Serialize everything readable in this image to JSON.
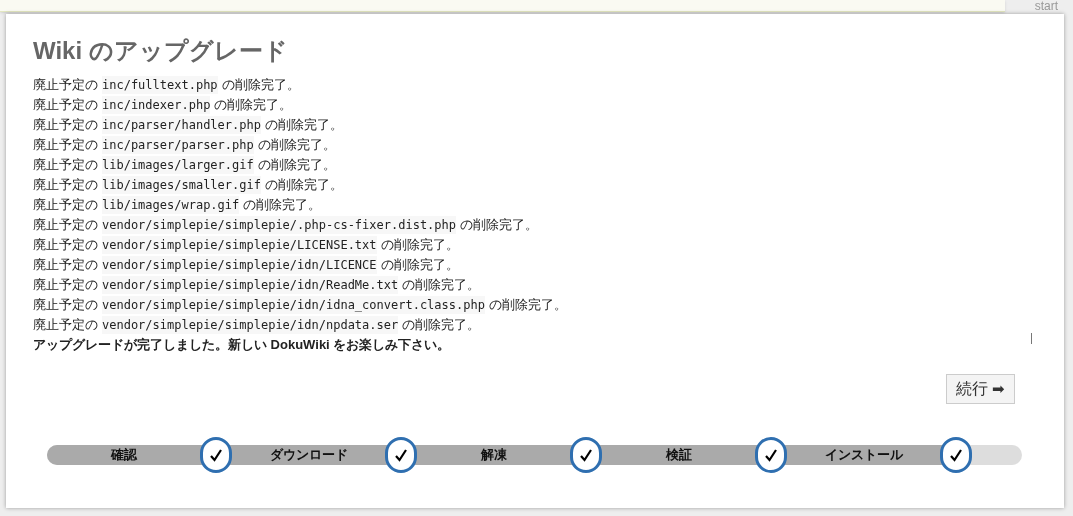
{
  "top_bar": {
    "link": "start"
  },
  "title": "Wiki のアップグレード",
  "log": [
    {
      "prefix": "廃止予定の",
      "path": "inc/fulltext.php",
      "suffix": "の削除完了。"
    },
    {
      "prefix": "廃止予定の",
      "path": "inc/indexer.php",
      "suffix": "の削除完了。"
    },
    {
      "prefix": "廃止予定の",
      "path": "inc/parser/handler.php",
      "suffix": "の削除完了。"
    },
    {
      "prefix": "廃止予定の",
      "path": "inc/parser/parser.php",
      "suffix": "の削除完了。"
    },
    {
      "prefix": "廃止予定の",
      "path": "lib/images/larger.gif",
      "suffix": "の削除完了。"
    },
    {
      "prefix": "廃止予定の",
      "path": "lib/images/smaller.gif",
      "suffix": "の削除完了。"
    },
    {
      "prefix": "廃止予定の",
      "path": "lib/images/wrap.gif",
      "suffix": "の削除完了。"
    },
    {
      "prefix": "廃止予定の",
      "path": "vendor/simplepie/simplepie/.php-cs-fixer.dist.php",
      "suffix": "の削除完了。"
    },
    {
      "prefix": "廃止予定の",
      "path": "vendor/simplepie/simplepie/LICENSE.txt",
      "suffix": "の削除完了。"
    },
    {
      "prefix": "廃止予定の",
      "path": "vendor/simplepie/simplepie/idn/LICENCE",
      "suffix": "の削除完了。"
    },
    {
      "prefix": "廃止予定の",
      "path": "vendor/simplepie/simplepie/idn/ReadMe.txt",
      "suffix": "の削除完了。"
    },
    {
      "prefix": "廃止予定の",
      "path": "vendor/simplepie/simplepie/idn/idna_convert.class.php",
      "suffix": "の削除完了。"
    },
    {
      "prefix": "廃止予定の",
      "path": "vendor/simplepie/simplepie/idn/npdata.ser",
      "suffix": "の削除完了。"
    }
  ],
  "message": "アップグレードが完了しました。新しい DokuWiki をお楽しみ下さい。",
  "continue_button": {
    "label": "続行",
    "icon": "➡"
  },
  "progress": {
    "level": 0.94,
    "steps": [
      {
        "label": "確認",
        "done": true
      },
      {
        "label": "ダウンロード",
        "done": true
      },
      {
        "label": "解凍",
        "done": true
      },
      {
        "label": "検証",
        "done": true
      },
      {
        "label": "インストール",
        "done": true
      }
    ]
  }
}
